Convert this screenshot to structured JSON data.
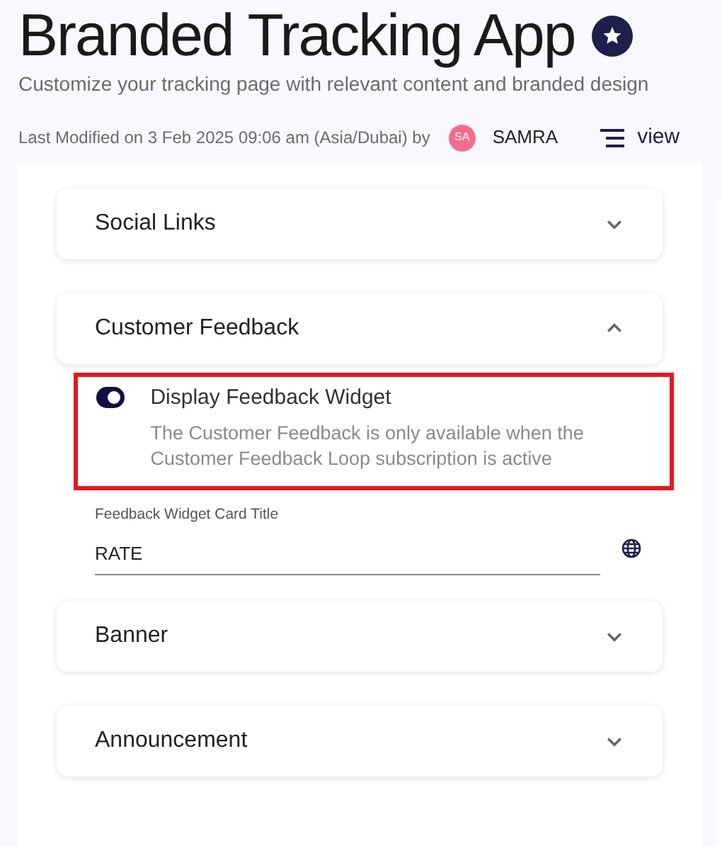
{
  "header": {
    "title": "Branded Tracking App",
    "subtitle": "Customize your tracking page with relevant content and branded design",
    "modified": "Last Modified on 3 Feb 2025 09:06 am (Asia/Dubai) by",
    "user_initials": "SA",
    "user_name": "SAMRA",
    "view_label": "view"
  },
  "sections": [
    {
      "title": "Social Links",
      "expanded": false
    },
    {
      "title": "Customer Feedback",
      "expanded": true,
      "highlighted": true,
      "toggle": {
        "label": "Display Feedback Widget",
        "on": true,
        "note": "The Customer Feedback is only available when the Customer Feedback Loop subscription is active"
      },
      "field": {
        "label": "Feedback Widget Card Title",
        "value": "RATE"
      }
    },
    {
      "title": "Banner",
      "expanded": false
    },
    {
      "title": "Announcement",
      "expanded": false
    }
  ]
}
